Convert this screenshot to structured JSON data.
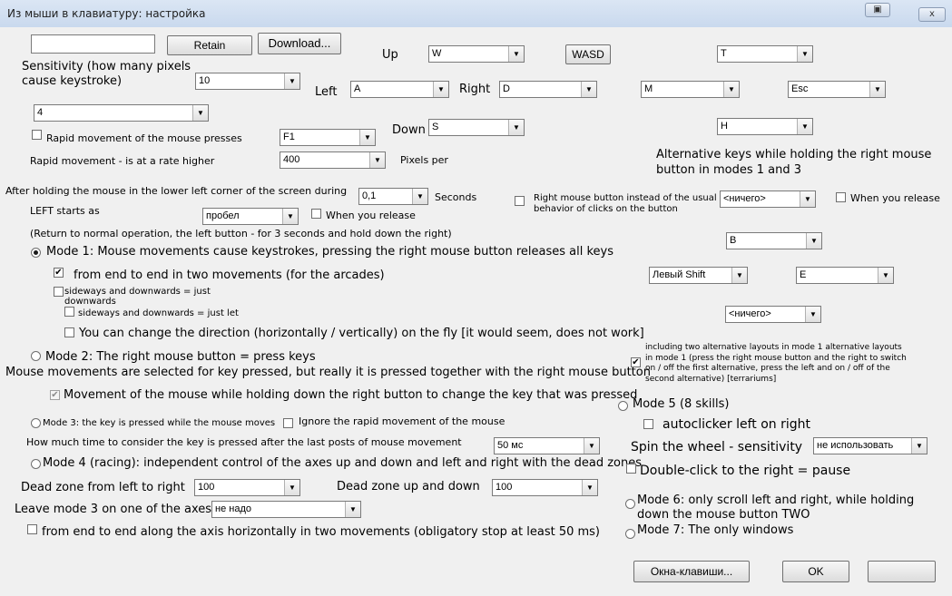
{
  "window": {
    "title": "Из мыши в клавиатуру: настройка",
    "close_glyph": "x"
  },
  "top": {
    "retain_label": "Retain",
    "download_label": "Download...",
    "sensitivity_label": "Sensitivity (how many pixels cause keystroke)",
    "sensitivity_value": "10",
    "mode_select_value": "4"
  },
  "keys": {
    "up_label": "Up",
    "up_value": "W",
    "left_label": "Left",
    "left_value": "A",
    "right_label": "Right",
    "right_value": "D",
    "down_label": "Down",
    "down_value": "S",
    "wasd_label": "WASD",
    "alt_up": "T",
    "alt_left": "M",
    "alt_right": "Esc",
    "alt_down": "H",
    "alt_caption": "Alternative keys while holding the right mouse button in modes 1 and 3"
  },
  "rapid": {
    "presses_label": "Rapid movement of the mouse presses",
    "presses_value": "F1",
    "rate_label": "Rapid movement - is at a rate higher",
    "rate_value": "400",
    "rate_unit": "Pixels per"
  },
  "corner": {
    "hold_label": "After holding the mouse in the lower left corner of the screen during",
    "hold_value": "0,1",
    "hold_unit": "Seconds",
    "left_starts_label": "LEFT starts as",
    "left_starts_value": "пробел",
    "when_release_label": "When you release",
    "return_note": "(Return to normal operation, the left button - for 3 seconds and hold down the right)"
  },
  "rmb": {
    "instead_label": "Right mouse button instead of the usual behavior of clicks on the button",
    "instead_value": "<ничего>",
    "when_release_label": "When you release"
  },
  "mode1": {
    "label": "Mode 1: Mouse movements cause keystrokes, pressing the right mouse button releases all keys",
    "end_to_end": "from end to end in two movements (for the arcades)",
    "sideways_down": "sideways and downwards = just downwards",
    "sideways_let": "sideways and downwards = just let",
    "change_dir": "You can change the direction (horizontally / vertically) on the fly [it would seem, does not work]"
  },
  "mode1_keys": {
    "b_value": "B",
    "shift_value": "Левый Shift",
    "e_value": "E",
    "nothing_value": "<ничего>"
  },
  "mode2": {
    "label": "Mode 2: The right mouse button = press keys",
    "note": "Mouse movements are selected for key pressed, but really it is pressed together with the right mouse button",
    "movement_label": "Movement of the mouse while holding down the right button to change the key that was pressed"
  },
  "alt_layouts": {
    "label": "including two alternative layouts in mode 1 alternative layouts in mode 1 (press the right mouse button and the right to switch on / off the first alternative, press the left and on / off of the second alternative) [terrariums]"
  },
  "mode3": {
    "label": "Mode 3: the key is pressed while the mouse moves",
    "ignore_label": "Ignore the rapid movement of the mouse",
    "time_label": "How much time to consider the key is pressed after the last posts of mouse movement",
    "time_value": "50 мс"
  },
  "mode4": {
    "label": "Mode 4 (racing): independent control of the axes up and down and left and right with the dead zones",
    "dead_lr_label": "Dead zone from left to right",
    "dead_lr_value": "100",
    "dead_ud_label": "Dead zone up and down",
    "dead_ud_value": "100",
    "leave_label": "Leave mode 3 on one of the axes",
    "leave_value": "не надо",
    "axis_label": "from end to end along the axis horizontally in two movements (obligatory stop at least 50 ms)"
  },
  "mode5": {
    "label": "Mode 5 (8 skills)",
    "autoclicker_label": "autoclicker left on right",
    "spin_label": "Spin the wheel - sensitivity",
    "spin_value": "не использовать",
    "double_click_label": "Double-click to the right = pause"
  },
  "mode6": {
    "label": "Mode 6: only scroll left and right, while holding down the mouse button TWO"
  },
  "mode7": {
    "label": "Mode 7: The only windows"
  },
  "footer": {
    "windows_keys_label": "Окна-клавиши...",
    "ok_label": "OK"
  }
}
